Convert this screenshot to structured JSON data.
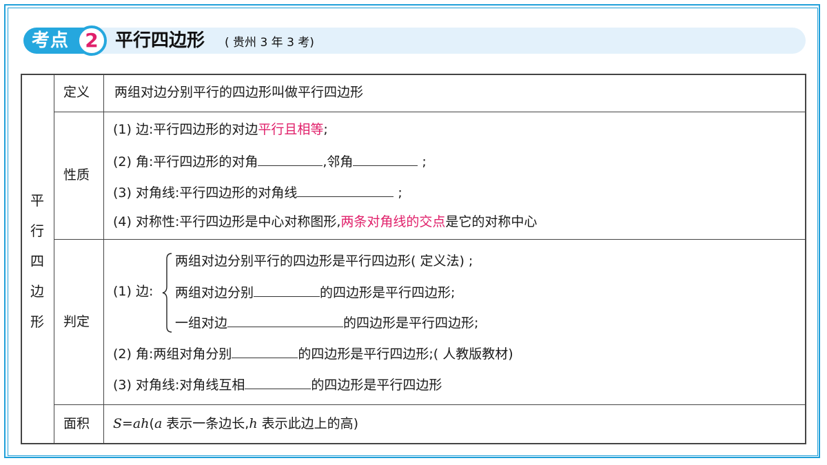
{
  "header": {
    "kaodian_label": "考点",
    "number": "2",
    "title": "平行四边形",
    "subtitle": "( 贵州 3 年 3 考)"
  },
  "row_header": "平行四边形",
  "row_header_chars": [
    "平",
    "行",
    "四",
    "边",
    "形"
  ],
  "definition": {
    "label": "定义",
    "text": "两组对边分别平行的四边形叫做平行四边形"
  },
  "properties": {
    "label": "性质",
    "p1_prefix": "(1) 边:平行四边形的对边",
    "p1_highlight": "平行且相等",
    "p1_suffix": ";",
    "p2_prefix": "(2) 角:平行四边形的对角",
    "p2_mid": ",邻角",
    "p2_suffix": ";",
    "p3_prefix": "(3) 对角线:平行四边形的对角线",
    "p3_suffix": ";",
    "p4_prefix": "(4) 对称性:平行四边形是中心对称图形,",
    "p4_highlight": "两条对角线的交点",
    "p4_suffix": "是它的对称中心"
  },
  "criteria": {
    "label": "判定",
    "c1_label": "(1) 边:",
    "c1_a": "两组对边分别平行的四边形是平行四边形( 定义法) ;",
    "c1_b_prefix": "两组对边分别",
    "c1_b_suffix": "的四边形是平行四边形;",
    "c1_c_prefix": "一组对边",
    "c1_c_suffix": "的四边形是平行四边形;",
    "c2_prefix": "(2) 角:两组对角分别",
    "c2_suffix": "的四边形是平行四边形;( 人教版教材)",
    "c3_prefix": "(3) 对角线:对角线互相",
    "c3_suffix": "的四边形是平行四边形"
  },
  "area": {
    "label": "面积",
    "formula": "S=ah",
    "desc_open": "(",
    "a_var": "a",
    "desc_mid": " 表示一条边长,",
    "h_var": "h",
    "desc_end": " 表示此边上的高)"
  },
  "colors": {
    "accent_blue": "#25a7de",
    "highlight_pink": "#e0206a",
    "header_bg": "#e3f1fb"
  }
}
